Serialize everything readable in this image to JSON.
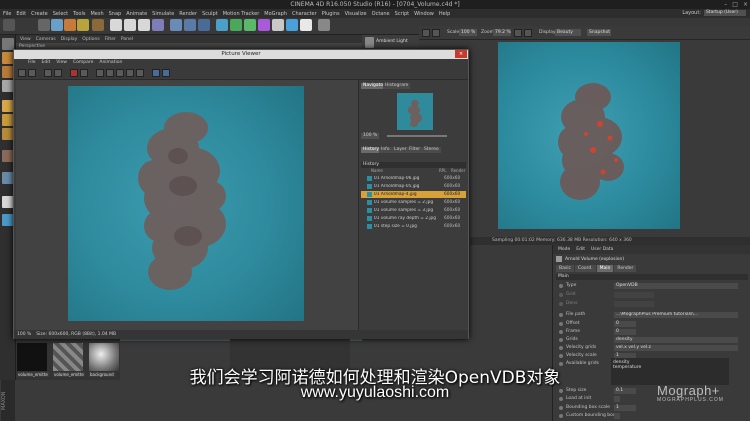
{
  "window": {
    "title": "CINEMA 4D R16.050 Studio (R16) - [0704_Volume.c4d *]",
    "controls": [
      "–",
      "□",
      "×"
    ]
  },
  "menubar": {
    "items": [
      "File",
      "Edit",
      "Create",
      "Select",
      "Tools",
      "Mesh",
      "Snap",
      "Animate",
      "Simulate",
      "Render",
      "Sculpt",
      "Motion Tracker",
      "MoGraph",
      "Character",
      "Plugins",
      "Visualize",
      "Octane",
      "Script",
      "Window",
      "Help"
    ],
    "layout_label": "Layout:",
    "layout_value": "Startup (User)"
  },
  "viewport": {
    "menu": [
      "View",
      "Cameras",
      "Display",
      "Options",
      "Filter",
      "Panel"
    ],
    "perspective": "Perspective"
  },
  "object_panel": {
    "label": "Ambient Light"
  },
  "render_toolbar": {
    "scale_label": "Scale",
    "scale_value": "100 %",
    "zoom_label": "Zoom",
    "zoom_value": "79.2 %",
    "display_label": "Display",
    "display_value": "Beauty",
    "snapshot": "Snapshot"
  },
  "render_status": "Sampling  00:01:02  Memory: 636.38 MB  Resolution: 640 x 360",
  "attributes": {
    "menu": [
      "Mode",
      "Edit",
      "User Data"
    ],
    "object_name": "Arnold Volume (explosion)",
    "tabs": [
      "Basic",
      "Coord.",
      "Main",
      "Render"
    ],
    "active_tab": "Main",
    "section": "Main",
    "rows": [
      {
        "k": "Type",
        "v": "OpenVDB"
      },
      {
        "k": "Grid",
        "v": ""
      },
      {
        "k": "Dens",
        "v": ""
      },
      {
        "k": "File path",
        "v": "...\\MographPlus Premium tutorials\\..."
      },
      {
        "k": "Offset",
        "v": "0"
      },
      {
        "k": "Frame",
        "v": "0"
      },
      {
        "k": "Grids",
        "v": "density"
      },
      {
        "k": "Velocity grids",
        "v": "vel.x vel.y vel.z"
      },
      {
        "k": "Velocity scale",
        "v": "1"
      },
      {
        "k": "Available grids",
        "v": ""
      },
      {
        "k": "Step size",
        "v": "0.1"
      },
      {
        "k": "Load at init",
        "v": ""
      },
      {
        "k": "Bounding box scale",
        "v": "1"
      },
      {
        "k": "Custom bounding box",
        "v": ""
      }
    ],
    "available_grids": [
      "density",
      "temperature"
    ]
  },
  "materials": [
    {
      "name": "volume_emitte"
    },
    {
      "name": "volume_emitte"
    },
    {
      "name": "background"
    }
  ],
  "picture_viewer": {
    "title": "Picture Viewer",
    "close": "×",
    "menu": [
      "File",
      "Edit",
      "View",
      "Compare",
      "Animation"
    ],
    "status_zoom": "100 %",
    "status_info": "Size: 600x600, RGB (8Bit), 1.04 MB",
    "nav_tabs": [
      "Navigator",
      "Histogram"
    ],
    "nav_zoom": "100 %",
    "hist_tabs": [
      "History",
      "Info",
      "Layer",
      "Filter",
      "Stereo"
    ],
    "history_header": "History",
    "history_cols": [
      "Name",
      "RPL",
      "Render"
    ],
    "history": [
      {
        "name": "01 Arnoldmap-06.jpg",
        "size": "600x60"
      },
      {
        "name": "01 Arnoldmap-05.jpg",
        "size": "600x60"
      },
      {
        "name": "01 Arnoldmap-4.jpg",
        "size": "600x60",
        "selected": true
      },
      {
        "name": "01 volume samples = 2.jpg",
        "size": "600x60"
      },
      {
        "name": "01 volume samples = 3.jpg",
        "size": "600x60"
      },
      {
        "name": "01 volume ray depth = 2.jpg",
        "size": "600x60"
      },
      {
        "name": "01 step size = 0.jpg",
        "size": "600x60"
      }
    ]
  },
  "subtitles": {
    "line1": "我们会学习阿诺德如何处理和渲染OpenVDB对象",
    "line2": "www.yuyulaoshi.com"
  },
  "watermark": {
    "brand": "Mograph+",
    "url": "MOGRAPHPLUS.COM"
  },
  "colors": {
    "teal_background": "#2e8a9d",
    "smoke": "#6a5a58",
    "fire": "#e0402a",
    "history_selected": "#d7a23a"
  }
}
